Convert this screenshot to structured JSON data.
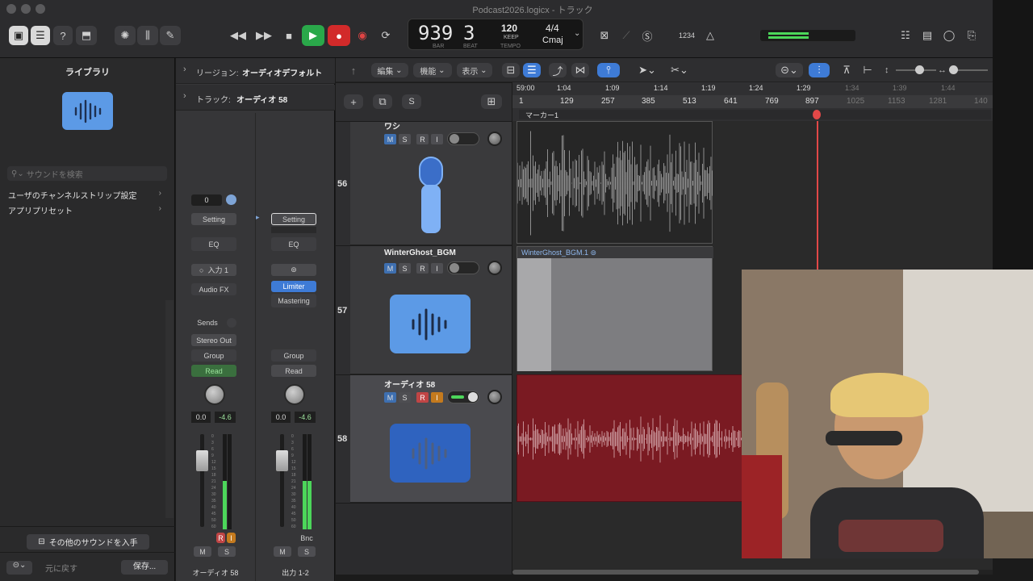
{
  "window": {
    "title": "Podcast2026.logicx - トラック"
  },
  "lcd": {
    "bar": "939",
    "beat": "3",
    "bar_label": "BAR",
    "beat_label": "BEAT",
    "tempo": "120",
    "keep": "KEEP",
    "tempo_label": "TEMPO",
    "signature": "4/4",
    "key": "Cmaj"
  },
  "toolbar": {
    "count_in": "1234"
  },
  "library": {
    "title": "ライブラリ",
    "search_placeholder": "サウンドを検索",
    "items": [
      "ユーザのチャンネルストリップ設定",
      "アプリプリセット"
    ],
    "get_more": "その他のサウンドを入手",
    "revert": "元に戻す",
    "save": "保存..."
  },
  "inspector": {
    "region_label": "リージョン:",
    "region_value": "オーディオデフォルト",
    "track_label": "トラック:",
    "track_value": "オーディオ 58"
  },
  "strip1": {
    "value": "0",
    "setting": "Setting",
    "eq": "EQ",
    "input": "入力 1",
    "audio_fx": "Audio FX",
    "sends": "Sends",
    "output": "Stereo Out",
    "group": "Group",
    "automation": "Read",
    "vol": "0.0",
    "peak": "-4.6",
    "r": "R",
    "i": "I",
    "m": "M",
    "s": "S",
    "name": "オーディオ 58"
  },
  "strip2": {
    "setting": "Setting",
    "eq": "EQ",
    "plugin1": "Limiter",
    "plugin2": "Mastering",
    "group": "Group",
    "automation": "Read",
    "vol": "0.0",
    "peak": "-4.6",
    "bnc": "Bnc",
    "m": "M",
    "s": "S",
    "name": "出力 1-2"
  },
  "meter_scale": [
    "0",
    "3",
    "6",
    "9",
    "12",
    "15",
    "18",
    "21",
    "24",
    "30",
    "35",
    "40",
    "45",
    "50",
    "60"
  ],
  "edit_menu": {
    "edit": "編集",
    "functions": "機能",
    "view": "表示"
  },
  "track_list_bar": {
    "s": "S"
  },
  "ruler": {
    "times": [
      "59:00",
      "1:04",
      "1:09",
      "1:14",
      "1:19",
      "1:24",
      "1:29",
      "1:34",
      "1:39",
      "1:44"
    ],
    "bars": [
      "1",
      "129",
      "257",
      "385",
      "513",
      "641",
      "769",
      "897",
      "1025",
      "1153",
      "1281",
      "140"
    ],
    "marker": "マーカー1"
  },
  "tracks": [
    {
      "number": "56",
      "name": "ワシ",
      "m": "M",
      "s": "S",
      "r": "R",
      "i": "I"
    },
    {
      "number": "57",
      "name": "WinterGhost_BGM",
      "m": "M",
      "s": "S",
      "r": "R",
      "i": "I"
    },
    {
      "number": "58",
      "name": "オーディオ 58",
      "m": "M",
      "s": "S",
      "r": "R",
      "i": "I"
    }
  ],
  "regions": {
    "bgm": "WinterGhost_BGM.1"
  },
  "colors": {
    "accent": "#3e7bd6",
    "record": "#d22a2a",
    "play": "#2aa84a",
    "region_red": "#7a1a22",
    "region_gray": "#7d7d80"
  }
}
